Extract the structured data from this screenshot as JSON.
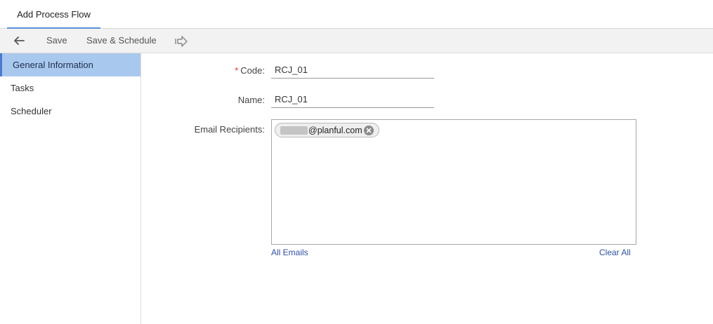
{
  "tab": {
    "title": "Add Process Flow"
  },
  "toolbar": {
    "back_icon": "arrow-left-icon",
    "save_label": "Save",
    "save_schedule_label": "Save & Schedule",
    "forward_icon": "arrow-right-outline-icon"
  },
  "sidebar": {
    "items": [
      {
        "label": "General Information",
        "active": true
      },
      {
        "label": "Tasks",
        "active": false
      },
      {
        "label": "Scheduler",
        "active": false
      }
    ]
  },
  "form": {
    "code": {
      "required_mark": "*",
      "label": "Code:",
      "value": "RCJ_01"
    },
    "name": {
      "label": "Name:",
      "value": "RCJ_01"
    },
    "email": {
      "label": "Email Recipients:",
      "chips": [
        {
          "text": "@planful.com"
        }
      ],
      "all_emails_label": "All Emails",
      "clear_all_label": "Clear All"
    }
  },
  "colors": {
    "active_sidebar_bg": "#a9c8ee",
    "active_sidebar_border": "#4a7bd0",
    "required": "#d9342b",
    "link": "#2f4f9f"
  }
}
